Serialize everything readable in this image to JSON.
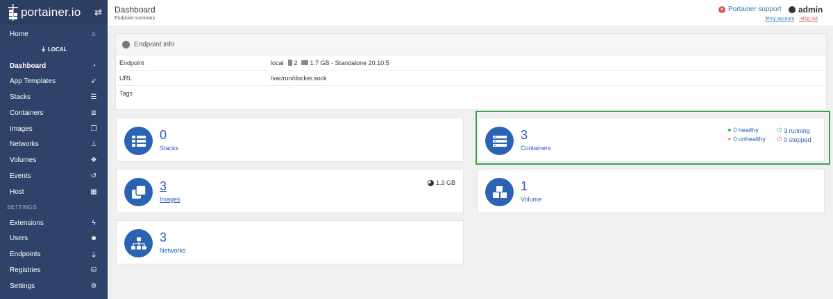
{
  "brand": {
    "name": "portainer.io",
    "toggle_icon": "exchange-icon"
  },
  "sidebar": {
    "endpoint": "LOCAL",
    "section_settings": "SETTINGS",
    "items": [
      {
        "label": "Home",
        "icon": "home-icon"
      },
      {
        "label": "Dashboard",
        "icon": "tachometer-icon",
        "active": true
      },
      {
        "label": "App Templates",
        "icon": "rocket-icon"
      },
      {
        "label": "Stacks",
        "icon": "th-list-icon"
      },
      {
        "label": "Containers",
        "icon": "server-icon"
      },
      {
        "label": "Images",
        "icon": "clone-icon"
      },
      {
        "label": "Networks",
        "icon": "sitemap-icon"
      },
      {
        "label": "Volumes",
        "icon": "cubes-icon"
      },
      {
        "label": "Events",
        "icon": "history-icon"
      },
      {
        "label": "Host",
        "icon": "th-icon"
      },
      {
        "label": "Extensions",
        "icon": "bolt-icon"
      },
      {
        "label": "Users",
        "icon": "users-icon"
      },
      {
        "label": "Endpoints",
        "icon": "plug-icon"
      },
      {
        "label": "Registries",
        "icon": "database-icon"
      },
      {
        "label": "Settings",
        "icon": "cogs-icon"
      }
    ]
  },
  "header": {
    "title": "Dashboard",
    "subtitle": "Endpoint summary",
    "support": "Portainer support",
    "user": "admin",
    "my_account": "my account",
    "log_out": "log out"
  },
  "endpoint_info": {
    "title": "Endpoint info",
    "rows": [
      {
        "key": "Endpoint",
        "name": "local",
        "cpu": "2",
        "memory": "1.7 GB",
        "type": "- Standalone 20.10.5"
      },
      {
        "key": "URL",
        "value": "/var/run/docker.sock"
      },
      {
        "key": "Tags",
        "value": ""
      }
    ]
  },
  "widgets": {
    "stacks": {
      "count": "0",
      "label": "Stacks"
    },
    "containers": {
      "count": "3",
      "label": "Containers",
      "healthy": "0 healthy",
      "unhealthy": "0 unhealthy",
      "running": "3 running",
      "stopped": "0 stopped"
    },
    "images": {
      "count": "3",
      "label": "Images",
      "size": "1.3 GB"
    },
    "volumes": {
      "count": "1",
      "label": "Volume"
    },
    "networks": {
      "count": "3",
      "label": "Networks"
    }
  },
  "colors": {
    "sidebar": "#30426a",
    "accent": "#2a62b4",
    "highlight": "#35a83a",
    "danger": "#d9534f",
    "success": "#28a745"
  }
}
